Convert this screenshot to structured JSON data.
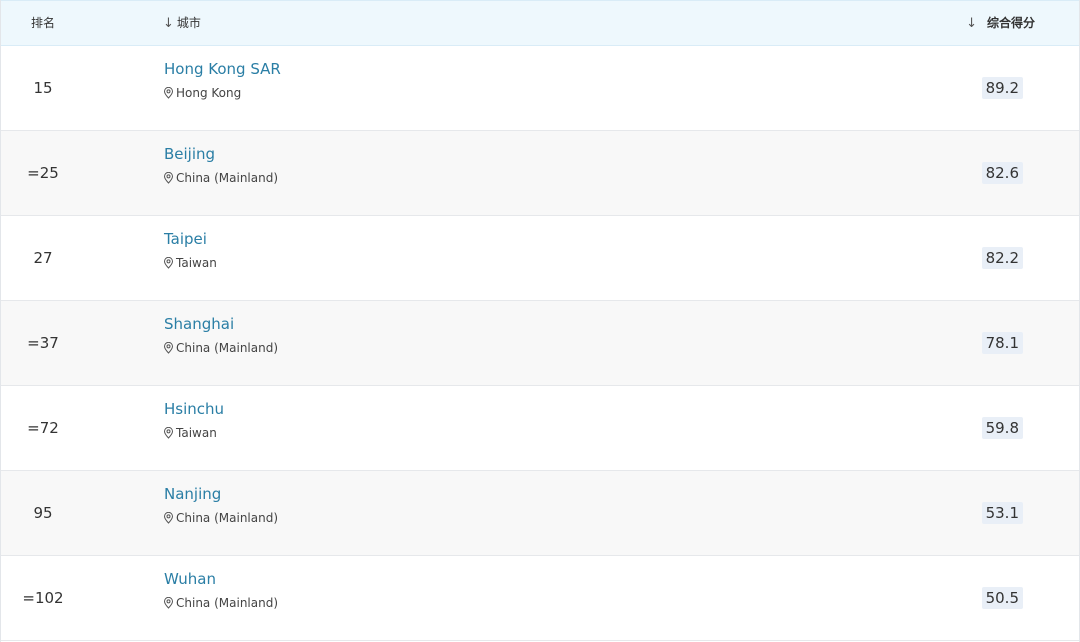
{
  "header": {
    "rank_label": "排名",
    "city_label": "城市",
    "score_label": "综合得分",
    "sort_arrow": "↓"
  },
  "rows": [
    {
      "rank": "15",
      "city": "Hong Kong SAR",
      "location": "Hong Kong",
      "score": "89.2"
    },
    {
      "rank": "=25",
      "city": "Beijing",
      "location": "China (Mainland)",
      "score": "82.6"
    },
    {
      "rank": "27",
      "city": "Taipei",
      "location": "Taiwan",
      "score": "82.2"
    },
    {
      "rank": "=37",
      "city": "Shanghai",
      "location": "China (Mainland)",
      "score": "78.1"
    },
    {
      "rank": "=72",
      "city": "Hsinchu",
      "location": "Taiwan",
      "score": "59.8"
    },
    {
      "rank": "95",
      "city": "Nanjing",
      "location": "China (Mainland)",
      "score": "53.1"
    },
    {
      "rank": "=102",
      "city": "Wuhan",
      "location": "China (Mainland)",
      "score": "50.5"
    }
  ],
  "colors": {
    "header_bg": "#eef8fd",
    "city_link": "#2a7ea5",
    "score_badge": "#e9eff7",
    "alt_row": "#f8f8f8"
  },
  "icons": {
    "location": "map-pin-icon",
    "sort": "arrow-down-icon"
  }
}
